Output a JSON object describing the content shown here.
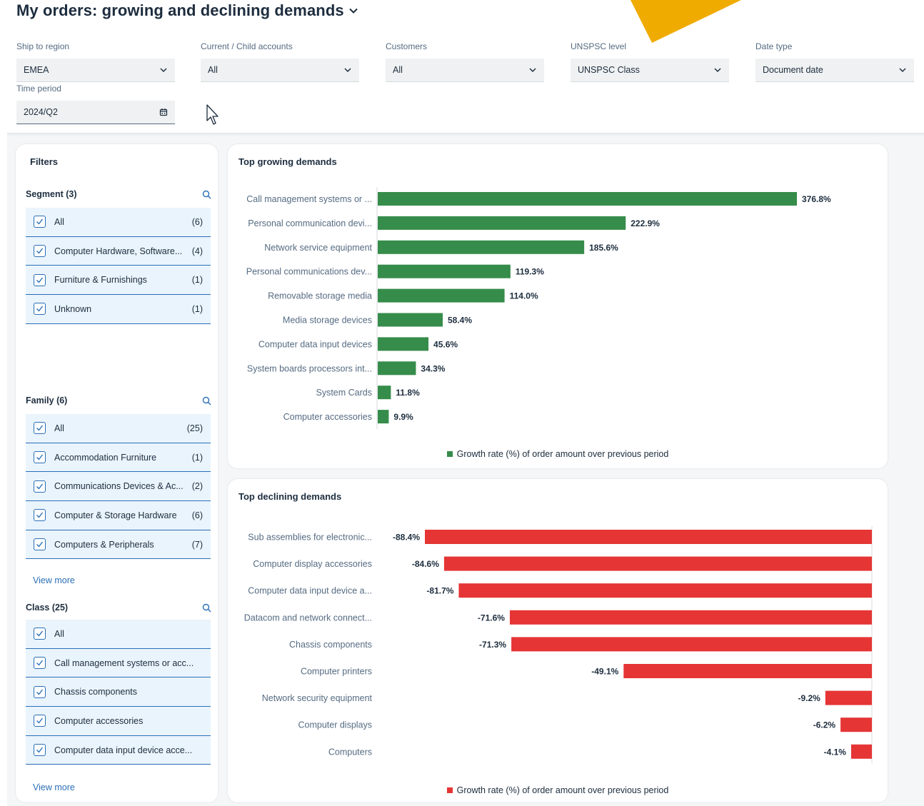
{
  "header": {
    "title": "My orders: growing and declining demands"
  },
  "filterbar": {
    "fields": [
      {
        "label": "Ship to region",
        "value": "EMEA"
      },
      {
        "label": "Current / Child accounts",
        "value": "All"
      },
      {
        "label": "Customers",
        "value": "All"
      },
      {
        "label": "UNSPSC level",
        "value": "UNSPSC Class"
      },
      {
        "label": "Date type",
        "value": "Document date"
      }
    ],
    "time_period": {
      "label": "Time period",
      "value": "2024/Q2"
    }
  },
  "filters": {
    "title": "Filters",
    "segment": {
      "title": "Segment (3)",
      "items": [
        {
          "label": "All",
          "count": "(6)"
        },
        {
          "label": "Computer Hardware, Software...",
          "count": "(4)"
        },
        {
          "label": "Furniture & Furnishings",
          "count": "(1)"
        },
        {
          "label": "Unknown",
          "count": "(1)"
        }
      ]
    },
    "family": {
      "title": "Family (6)",
      "items": [
        {
          "label": "All",
          "count": "(25)"
        },
        {
          "label": "Accommodation Furniture",
          "count": "(1)"
        },
        {
          "label": "Communications Devices & Ac...",
          "count": "(2)"
        },
        {
          "label": "Computer & Storage Hardware",
          "count": "(6)"
        },
        {
          "label": "Computers & Peripherals",
          "count": "(7)"
        }
      ],
      "view_more": "View more"
    },
    "class": {
      "title": "Class (25)",
      "items": [
        {
          "label": "All",
          "count": ""
        },
        {
          "label": "Call management systems or acc...",
          "count": ""
        },
        {
          "label": "Chassis components",
          "count": ""
        },
        {
          "label": "Computer accessories",
          "count": ""
        },
        {
          "label": "Computer data input device acce...",
          "count": ""
        }
      ],
      "view_more": "View more"
    }
  },
  "colors": {
    "growth": "#368c4a",
    "decline": "#e53535",
    "accent": "#2a6fb7"
  },
  "chart_data": [
    {
      "type": "bar",
      "orientation": "horizontal",
      "title": "Top growing demands",
      "categories": [
        "Call management systems or ...",
        "Personal communication devi...",
        "Network service equipment",
        "Personal communications dev...",
        "Removable storage media",
        "Media storage devices",
        "Computer data input devices",
        "System boards processors int...",
        "System Cards",
        "Computer accessories"
      ],
      "series": [
        {
          "name": "Growth rate (%) of order amount over previous period",
          "values": [
            376.8,
            222.9,
            185.6,
            119.3,
            114.0,
            58.4,
            45.6,
            34.3,
            11.8,
            9.9
          ]
        }
      ],
      "labels": [
        "376.8%",
        "222.9%",
        "185.6%",
        "119.3%",
        "114.0%",
        "58.4%",
        "45.6%",
        "34.3%",
        "11.8%",
        "9.9%"
      ],
      "color": "#368c4a",
      "legend": "bottom"
    },
    {
      "type": "bar",
      "orientation": "horizontal",
      "title": "Top declining demands",
      "categories": [
        "Sub assemblies for electronic...",
        "Computer display accessories",
        "Computer data input device a...",
        "Datacom and network connect...",
        "Chassis components",
        "Computer printers",
        "Network security equipment",
        "Computer displays",
        "Computers"
      ],
      "series": [
        {
          "name": "Growth rate (%) of order amount over previous period",
          "values": [
            -88.4,
            -84.6,
            -81.7,
            -71.6,
            -71.3,
            -49.1,
            -9.2,
            -6.2,
            -4.1
          ]
        }
      ],
      "labels": [
        "-88.4%",
        "-84.6%",
        "-81.7%",
        "-71.6%",
        "-71.3%",
        "-49.1%",
        "-9.2%",
        "-6.2%",
        "-4.1%"
      ],
      "color": "#e53535",
      "legend": "bottom"
    }
  ]
}
